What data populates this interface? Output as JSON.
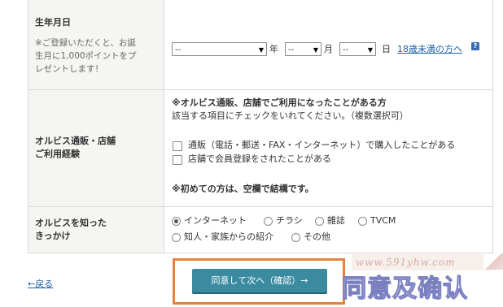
{
  "birthday": {
    "label": "生年月日",
    "note_lines": [
      "※ご登録いただくと、お誕",
      "生月に1,000ポイントをプ",
      "レゼントします！"
    ],
    "year_value": "--",
    "year_suffix": "年",
    "month_value": "--",
    "month_suffix": "月",
    "day_value": "--",
    "day_suffix": "日",
    "under18_link": "18歳未満の方へ",
    "help_glyph": "?"
  },
  "experience": {
    "label_lines": [
      "オルビス通販・店舗",
      "ご利用経験"
    ],
    "heading": "※オルビス通販、店舗でご利用になったことがある方",
    "subheading": "該当する項目にチェックをいれてください。（複数選択可）",
    "options": [
      {
        "label": "通販（電話・郵送・FAX・インターネット）で購入したことがある",
        "checked": false
      },
      {
        "label": "店舗で会員登録をされたことがある",
        "checked": false
      }
    ],
    "first_time_note": "※初めての方は、空欄で結構です。"
  },
  "referral": {
    "label_lines": [
      "オルビスを知った",
      "きっかけ"
    ],
    "options": [
      {
        "label": "インターネット",
        "selected": true
      },
      {
        "label": "チラシ",
        "selected": false
      },
      {
        "label": "雑誌",
        "selected": false
      },
      {
        "label": "TVCM",
        "selected": false
      },
      {
        "label": "知人・家族からの紹介",
        "selected": false
      },
      {
        "label": "その他",
        "selected": false
      }
    ]
  },
  "footer": {
    "back_link": "←戻る",
    "submit_label": "同意して次へ（確認）→",
    "accent_color": "#3a8aa0",
    "highlight_color": "#e8813c",
    "watermark_url": "www.591yhw.com",
    "watermark_text": "同意及确认"
  }
}
